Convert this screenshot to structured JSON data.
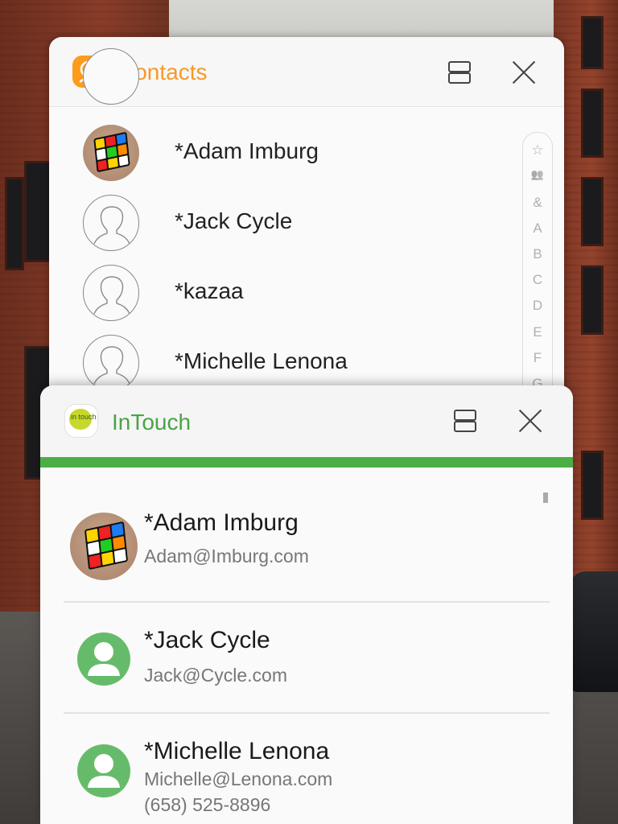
{
  "colors": {
    "contacts_accent": "#f59a2a",
    "intouch_accent": "#4aa445",
    "intouch_bar": "#4caf46"
  },
  "contacts": {
    "title": "Contacts",
    "icons": {
      "app": "contacts-app-icon",
      "split": "split-screen-icon",
      "close": "close-icon"
    },
    "list": [
      {
        "name": "*Adam Imburg",
        "avatar": "photo-rubiks-cube"
      },
      {
        "name": "*Jack Cycle",
        "avatar": "default-person-icon"
      },
      {
        "name": "*kazaa",
        "avatar": "default-person-icon"
      },
      {
        "name": "*Michelle Lenona",
        "avatar": "default-person-icon"
      }
    ],
    "index": [
      "☆",
      "👥",
      "&",
      "A",
      "B",
      "C",
      "D",
      "E",
      "F",
      "G"
    ]
  },
  "intouch": {
    "title": "InTouch",
    "icon_label": "in touch",
    "icons": {
      "app": "intouch-app-icon",
      "split": "split-screen-icon",
      "close": "close-icon"
    },
    "list": [
      {
        "name": "*Adam Imburg",
        "email": "Adam@Imburg.com",
        "phone": "",
        "avatar": "photo-rubiks-cube"
      },
      {
        "name": "*Jack Cycle",
        "email": "Jack@Cycle.com",
        "phone": "",
        "avatar": "green-person-icon"
      },
      {
        "name": "*Michelle Lenona",
        "email": "Michelle@Lenona.com",
        "phone": "(658) 525-8896",
        "avatar": "green-person-icon"
      }
    ]
  }
}
